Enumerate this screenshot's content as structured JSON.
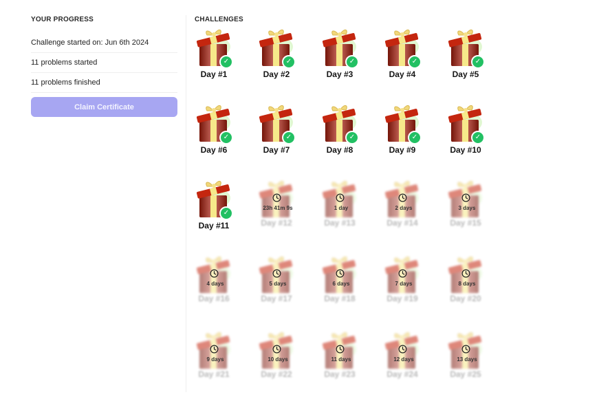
{
  "progress": {
    "title": "YOUR PROGRESS",
    "started_on": "Challenge started on: Jun 6th 2024",
    "problems_started": "11 problems started",
    "problems_finished": "11 problems finished",
    "claim_button": "Claim Certificate"
  },
  "challenges": {
    "title": "CHALLENGES",
    "days": [
      {
        "label": "Day #1",
        "status": "completed"
      },
      {
        "label": "Day #2",
        "status": "completed"
      },
      {
        "label": "Day #3",
        "status": "completed"
      },
      {
        "label": "Day #4",
        "status": "completed"
      },
      {
        "label": "Day #5",
        "status": "completed"
      },
      {
        "label": "Day #6",
        "status": "completed"
      },
      {
        "label": "Day #7",
        "status": "completed"
      },
      {
        "label": "Day #8",
        "status": "completed"
      },
      {
        "label": "Day #9",
        "status": "completed"
      },
      {
        "label": "Day #10",
        "status": "completed"
      },
      {
        "label": "Day #11",
        "status": "completed"
      },
      {
        "label": "Day #12",
        "status": "locked",
        "countdown": "23h 41m 9s"
      },
      {
        "label": "Day #13",
        "status": "locked",
        "countdown": "1 day"
      },
      {
        "label": "Day #14",
        "status": "locked",
        "countdown": "2 days"
      },
      {
        "label": "Day #15",
        "status": "locked",
        "countdown": "3 days"
      },
      {
        "label": "Day #16",
        "status": "locked",
        "countdown": "4 days"
      },
      {
        "label": "Day #17",
        "status": "locked",
        "countdown": "5 days"
      },
      {
        "label": "Day #18",
        "status": "locked",
        "countdown": "6 days"
      },
      {
        "label": "Day #19",
        "status": "locked",
        "countdown": "7 days"
      },
      {
        "label": "Day #20",
        "status": "locked",
        "countdown": "8 days"
      },
      {
        "label": "Day #21",
        "status": "locked",
        "countdown": "9 days"
      },
      {
        "label": "Day #22",
        "status": "locked",
        "countdown": "10 days"
      },
      {
        "label": "Day #23",
        "status": "locked",
        "countdown": "11 days"
      },
      {
        "label": "Day #24",
        "status": "locked",
        "countdown": "12 days"
      },
      {
        "label": "Day #25",
        "status": "locked",
        "countdown": "13 days"
      }
    ]
  },
  "icons": {
    "gift": "gift-icon",
    "check": "check-circle-icon",
    "clock": "clock-icon"
  },
  "colors": {
    "gift_red": "#b3200e",
    "ribbon_yellow": "#f6e98a",
    "check_green": "#22c063",
    "claim_button_bg": "#a7a6f2"
  }
}
